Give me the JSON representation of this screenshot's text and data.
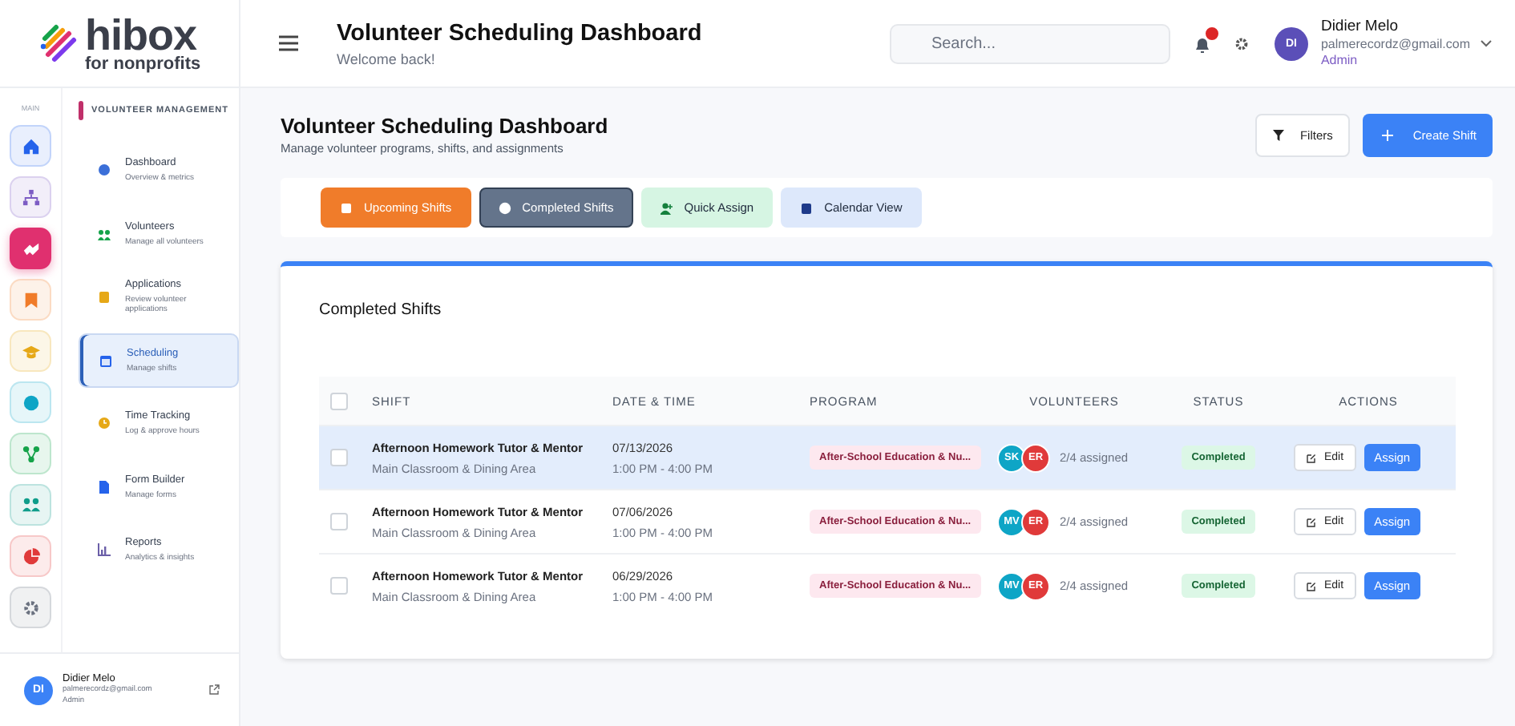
{
  "logo": {
    "name": "hibox",
    "tagline": "for nonprofits"
  },
  "header": {
    "title": "Volunteer Scheduling Dashboard",
    "subtitle": "Welcome back!",
    "search": {
      "placeholder": "Search..."
    },
    "user": {
      "initials": "DI",
      "name": "Didier Melo",
      "email": "palmerecordz@gmail.com",
      "role": "Admin"
    }
  },
  "rail": {
    "label": "MAIN",
    "items": [
      {
        "color": "#2563eb",
        "selected": false
      },
      {
        "color": "#7c5cc4",
        "selected": false
      },
      {
        "color": "#e0306f",
        "selected": true
      },
      {
        "color": "#f07c2a",
        "selected": false
      },
      {
        "color": "#e6a817",
        "selected": false
      },
      {
        "color": "#0ea5c6",
        "selected": false
      },
      {
        "color": "#16a34a",
        "selected": false
      },
      {
        "color": "#0f9d8a",
        "selected": false
      },
      {
        "color": "#e03a3a",
        "selected": false
      },
      {
        "color": "#6b7280",
        "selected": false
      }
    ]
  },
  "sidebar": {
    "section": "VOLUNTEER MANAGEMENT",
    "items": [
      {
        "label": "Dashboard",
        "subtitle": "Overview & metrics",
        "selected": false
      },
      {
        "label": "Volunteers",
        "subtitle": "Manage all volunteers",
        "selected": false
      },
      {
        "label": "Applications",
        "subtitle": "Review volunteer applications",
        "selected": false
      },
      {
        "label": "Scheduling",
        "subtitle": "Manage shifts",
        "selected": true
      },
      {
        "label": "Time Tracking",
        "subtitle": "Log & approve hours",
        "selected": false
      },
      {
        "label": "Form Builder",
        "subtitle": "Manage forms",
        "selected": false
      },
      {
        "label": "Reports",
        "subtitle": "Analytics & insights",
        "selected": false
      }
    ],
    "user": {
      "initials": "DI",
      "name": "Didier Melo",
      "email": "palmerecordz@gmail.com",
      "role": "Admin"
    }
  },
  "page": {
    "title": "Volunteer Scheduling Dashboard",
    "subtitle": "Manage volunteer programs, shifts, and assignments",
    "filters": "Filters",
    "create": "Create Shift"
  },
  "tabs": [
    {
      "label": "Upcoming Shifts",
      "selected": false,
      "color": "#f07c2a"
    },
    {
      "label": "Completed Shifts",
      "selected": true,
      "color": "#64748b"
    },
    {
      "label": "Quick Assign",
      "selected": false,
      "color": "#d6f5e3"
    },
    {
      "label": "Calendar View",
      "selected": false,
      "color": "#dde8fb"
    }
  ],
  "table": {
    "title": "Completed Shifts",
    "select_all_checked": false,
    "columns": [
      "SHIFT",
      "DATE & TIME",
      "PROGRAM",
      "VOLUNTEERS",
      "STATUS",
      "ACTIONS"
    ],
    "rows": [
      {
        "selected": true,
        "checked": false,
        "shift": "Afternoon Homework Tutor & Mentor",
        "location": "Main Classroom & Dining Area",
        "date": "07/13/2026",
        "time": "1:00 PM - 4:00 PM",
        "program": "After-School Education & Nu...",
        "volunteers": [
          {
            "initials": "SK",
            "color": "#0ea5c6"
          },
          {
            "initials": "ER",
            "color": "#e03a3a"
          }
        ],
        "assigned": "2/4 assigned",
        "status": "Completed",
        "edit": "Edit",
        "assign": "Assign"
      },
      {
        "selected": false,
        "checked": false,
        "shift": "Afternoon Homework Tutor & Mentor",
        "location": "Main Classroom & Dining Area",
        "date": "07/06/2026",
        "time": "1:00 PM - 4:00 PM",
        "program": "After-School Education & Nu...",
        "volunteers": [
          {
            "initials": "MV",
            "color": "#0ea5c6"
          },
          {
            "initials": "ER",
            "color": "#e03a3a"
          }
        ],
        "assigned": "2/4 assigned",
        "status": "Completed",
        "edit": "Edit",
        "assign": "Assign"
      },
      {
        "selected": false,
        "checked": false,
        "shift": "Afternoon Homework Tutor & Mentor",
        "location": "Main Classroom & Dining Area",
        "date": "06/29/2026",
        "time": "1:00 PM - 4:00 PM",
        "program": "After-School Education & Nu...",
        "volunteers": [
          {
            "initials": "MV",
            "color": "#0ea5c6"
          },
          {
            "initials": "ER",
            "color": "#e03a3a"
          }
        ],
        "assigned": "2/4 assigned",
        "status": "Completed",
        "edit": "Edit",
        "assign": "Assign"
      }
    ]
  }
}
